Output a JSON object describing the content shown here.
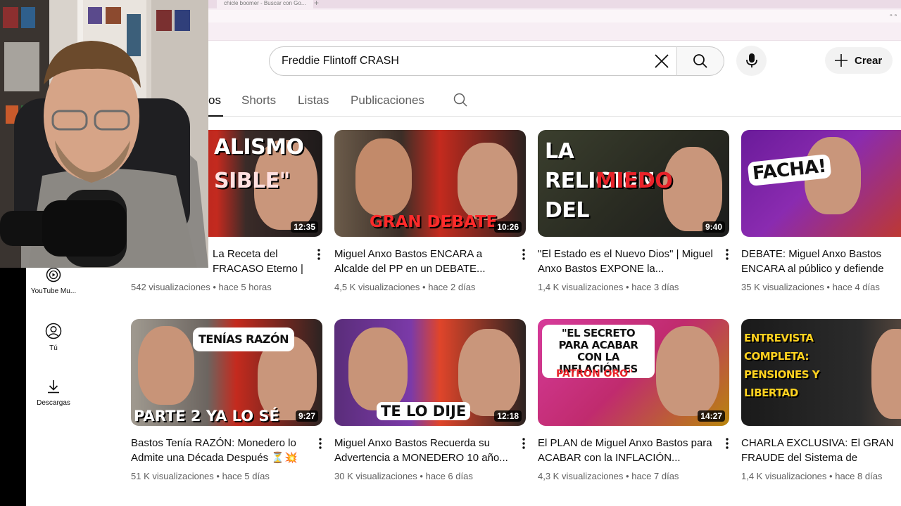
{
  "browser": {
    "tab_title": "chicle boomer - Buscar con Go...",
    "new_tab_icon": "plus-icon"
  },
  "header": {
    "search_value": "Freddie Flintoff CRASH",
    "clear_icon": "close-icon",
    "search_icon": "search-icon",
    "mic_icon": "microphone-icon",
    "create_label": "Crear"
  },
  "chips": {
    "active_fragment": "os",
    "items": [
      "Shorts",
      "Listas",
      "Publicaciones"
    ],
    "search_icon": "search-icon"
  },
  "sidebar": {
    "items": [
      {
        "label": "YouTube Mu...",
        "icon": "youtube-music-icon"
      },
      {
        "label": "Tú",
        "icon": "account-icon"
      },
      {
        "label": "Descargas",
        "icon": "download-icon"
      }
    ]
  },
  "videos": [
    {
      "thumb_top": "ALISMO",
      "thumb_bottom": "SIBLE\"",
      "duration": "12:35",
      "title": "La Receta del FRACASO Eterno | Miguel Anxo...",
      "title_prefix": "",
      "views": "542 visualizaciones",
      "age": "hace 5 horas"
    },
    {
      "thumb_top": "",
      "thumb_bottom": "GRAN DEBATE",
      "duration": "10:26",
      "title": "Miguel Anxo Bastos ENCARA a Alcalde del PP en un DEBATE...",
      "views": "4,5 K visualizaciones",
      "age": "hace 2 días"
    },
    {
      "thumb_top": "LA RELIGION DEL",
      "thumb_bottom": "MIEDO",
      "duration": "9:40",
      "title": "\"El Estado es el Nuevo Dios\" | Miguel Anxo Bastos EXPONE la...",
      "views": "1,4 K visualizaciones",
      "age": "hace 3 días"
    },
    {
      "thumb_top": "FACHA!",
      "thumb_bottom": "",
      "duration": "",
      "title": "DEBATE: Miguel Anxo Bastos ENCARA al público y defiende el...",
      "views": "35 K visualizaciones",
      "age": "hace 4 días"
    },
    {
      "thumb_top": "TENÍAS RAZÓN",
      "thumb_bottom": "PARTE 2  YA LO SÉ",
      "duration": "9:27",
      "title": "Bastos Tenía RAZÓN: Monedero lo Admite una Década Después ⏳💥",
      "views": "51 K visualizaciones",
      "age": "hace 5 días"
    },
    {
      "thumb_top": "",
      "thumb_bottom": "TE LO DIJE",
      "duration": "12:18",
      "title": "Miguel Anxo Bastos Recuerda su Advertencia a MONEDERO 10 año...",
      "views": "30 K visualizaciones",
      "age": "hace 6 días"
    },
    {
      "thumb_top": "\"EL SECRETO PARA ACABAR CON LA INFLACIÓN ES",
      "thumb_bottom": "PATRÓN ORO\"",
      "duration": "14:27",
      "title": "El PLAN de Miguel Anxo Bastos para ACABAR con la INFLACIÓN...",
      "views": "4,3 K visualizaciones",
      "age": "hace 7 días"
    },
    {
      "thumb_top": "ENTREVISTA COMPLETA: PENSIONES Y LIBERTAD",
      "thumb_bottom": "",
      "duration": "",
      "title": "CHARLA EXCLUSIVA: El GRAN FRAUDE del Sistema de Pensiones",
      "views": "1,4 K visualizaciones",
      "age": "hace 8 días"
    }
  ],
  "meta_separator": "•",
  "colors": {
    "text_primary": "#0f0f0f",
    "text_secondary": "#606060",
    "chip_border": "#e5e5e5",
    "thumb_red": "#c7141c",
    "thumb_purple": "#6a1b9a"
  }
}
